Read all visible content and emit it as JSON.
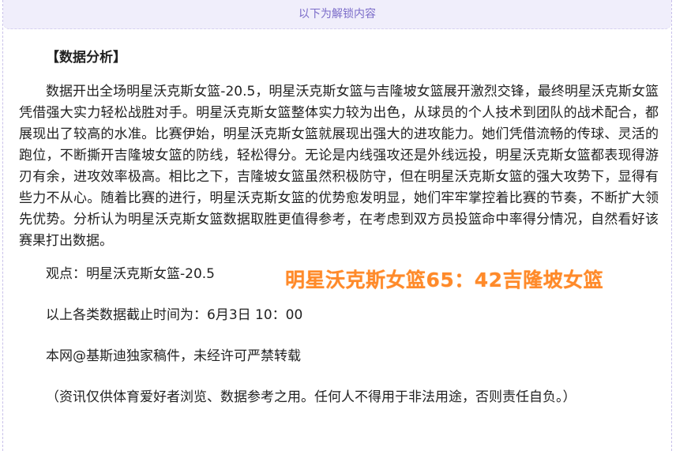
{
  "banner": {
    "unlock_text": "以下为解锁内容"
  },
  "article": {
    "section_title": "【数据分析】",
    "analysis": "数据开出全场明星沃克斯女篮-20.5，明星沃克斯女篮与吉隆坡女篮展开激烈交锋，最终明星沃克斯女篮凭借强大实力轻松战胜对手。明星沃克斯女篮整体实力较为出色，从球员的个人技术到团队的战术配合，都展现出了较高的水准。比赛伊始，明星沃克斯女篮就展现出强大的进攻能力。她们凭借流畅的传球、灵活的跑位，不断撕开吉隆坡女篮的防线，轻松得分。无论是内线强攻还是外线远投，明星沃克斯女篮都表现得游刃有余，进攻效率极高。相比之下，吉隆坡女篮虽然积极防守，但在明星沃克斯女篮的强大攻势下，显得有些力不从心。随着比赛的进行，明星沃克斯女篮的优势愈发明显，她们牢牢掌控着比赛的节奏，不断扩大领先优势。分析认为明星沃克斯女篮数据取胜更值得参考，在考虑到双方员投篮命中率得分情况，自然看好该赛果打出数据。",
    "viewpoint": "观点：明星沃克斯女篮-20.5",
    "cutoff": "以上各类数据截止时间为：6月3日 10：00",
    "copyright": "本网@基斯迪独家稿件，未经许可严禁转载",
    "disclaimer": "（资讯仅供体育爱好者浏览、数据参考之用。任何人不得用于非法用途，否则责任自负。）"
  },
  "score_overlay": {
    "text": "明星沃克斯女篮65：42吉隆坡女篮",
    "color": "#ff8a2a"
  }
}
